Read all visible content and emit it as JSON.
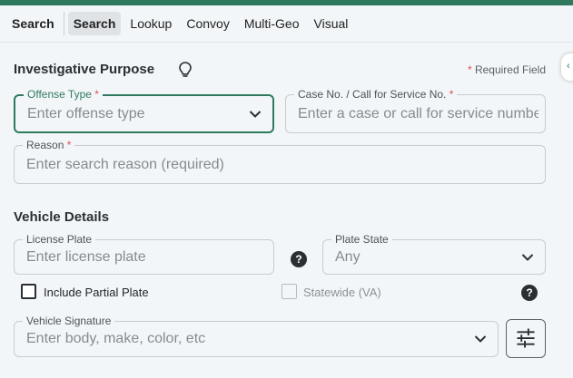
{
  "tabs": {
    "title": "Search",
    "items": [
      "Search",
      "Lookup",
      "Convoy",
      "Multi-Geo",
      "Visual"
    ],
    "active": "Search"
  },
  "investigative": {
    "title": "Investigative Purpose",
    "required_note": "Required Field",
    "offense_type": {
      "label": "Offense Type",
      "placeholder": "Enter offense type"
    },
    "case_no": {
      "label": "Case No. / Call for Service No.",
      "placeholder": "Enter a case or call for service number"
    },
    "reason": {
      "label": "Reason",
      "placeholder": "Enter search reason (required)"
    }
  },
  "vehicle": {
    "title": "Vehicle Details",
    "license_plate": {
      "label": "License Plate",
      "placeholder": "Enter license plate"
    },
    "plate_state": {
      "label": "Plate State",
      "value": "Any"
    },
    "partial_plate": {
      "label": "Include Partial Plate",
      "checked": false
    },
    "statewide": {
      "label": "Statewide (VA)",
      "checked": false,
      "disabled": true
    },
    "signature": {
      "label": "Vehicle Signature",
      "placeholder": "Enter body, make, color, etc"
    }
  },
  "colors": {
    "accent": "#2f7a5e",
    "required_star": "#d9534f"
  },
  "icons": {
    "bulb": "lightbulb-icon",
    "help": "question-circle-icon",
    "chevron": "chevron-down-icon",
    "tune": "sliders-icon"
  }
}
